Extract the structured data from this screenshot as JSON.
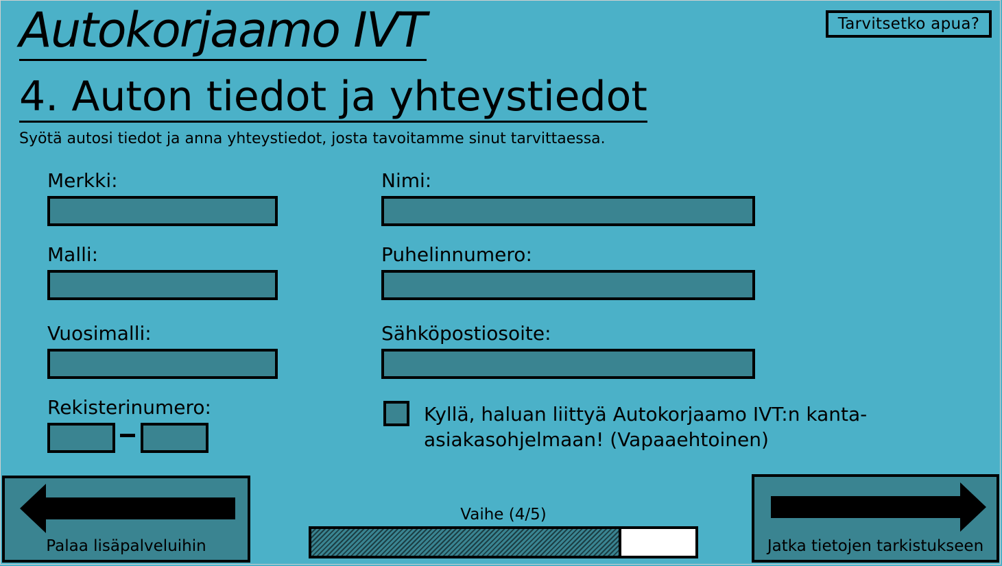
{
  "header": {
    "app_title": "Autokorjaamo IVT",
    "help_button": "Tarvitsetko apua?"
  },
  "step": {
    "title": "4. Auton tiedot ja yhteystiedot",
    "subtitle": "Syötä autosi tiedot ja anna yhteystiedot, josta tavoitamme sinut tarvittaessa."
  },
  "car_fields": {
    "brand_label": "Merkki:",
    "model_label": "Malli:",
    "year_label": "Vuosimalli:",
    "plate_label": "Rekisterinumero:",
    "plate_separator": "–"
  },
  "contact_fields": {
    "name_label": "Nimi:",
    "phone_label": "Puhelinnumero:",
    "email_label": "Sähköpostiosoite:"
  },
  "loyalty": {
    "checked": false,
    "label": "Kyllä, haluan liittyä Autokorjaamo IVT:n kanta-asiakasohjelmaan! (Vapaaehtoinen)"
  },
  "navigation": {
    "back_label": "Palaa lisäpalveluihin",
    "back_icon": "arrow-left-icon",
    "next_label": "Jatka tietojen tarkistukseen",
    "next_icon": "arrow-right-icon"
  },
  "progress": {
    "label": "Vaihe (4/5)",
    "current_step": 4,
    "total_steps": 5,
    "fill_fraction": 0.8
  },
  "colors": {
    "background": "#4bb1c8",
    "field_fill": "#3a8491",
    "outline": "#000000"
  }
}
